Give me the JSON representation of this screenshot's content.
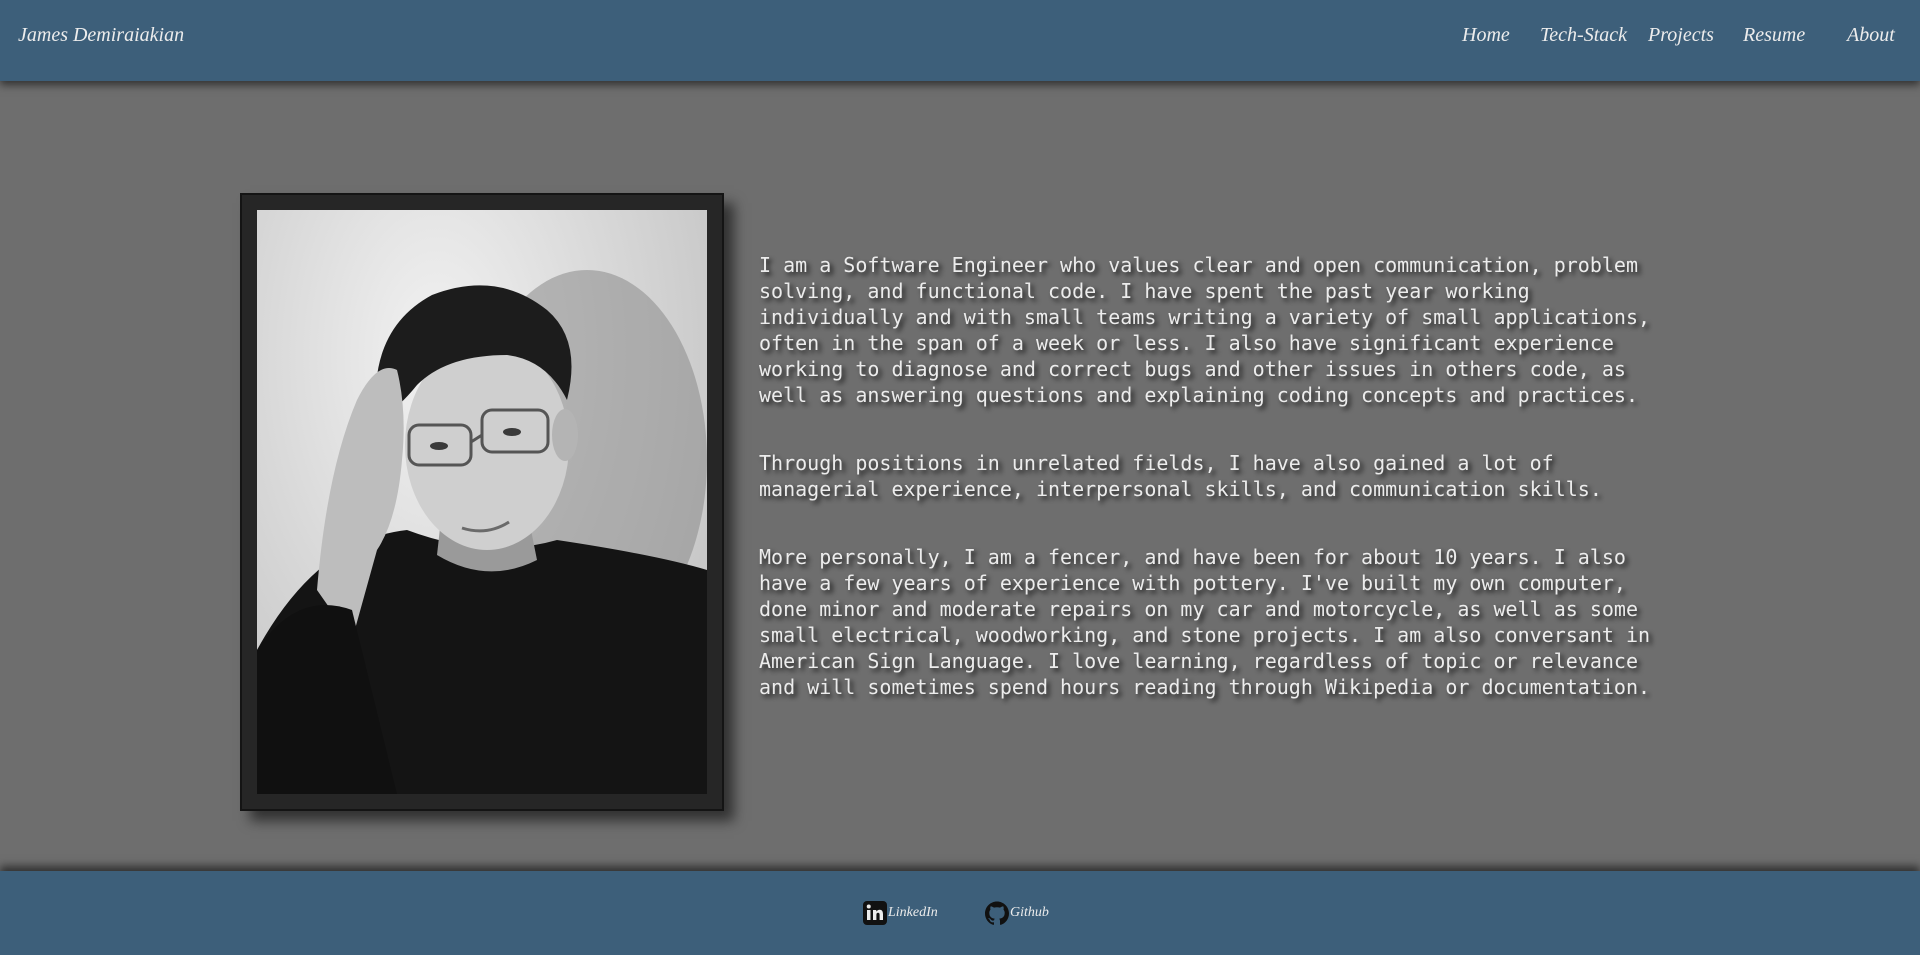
{
  "header": {
    "brand": "James Demiraiakian",
    "nav": [
      {
        "label": "Home"
      },
      {
        "label": "Tech-Stack"
      },
      {
        "label": "Projects"
      },
      {
        "label": "Resume"
      },
      {
        "label": "About"
      }
    ]
  },
  "about": {
    "paragraphs": [
      "I am a Software Engineer who values clear and open communication, problem solving, and functional code. I have spent the past year working individually and with small teams writing a variety of small applications, often in the span of a week or less. I also have significant experience working to diagnose and correct bugs and other issues in others code, as well as answering questions and explaining coding concepts and practices.",
      "Through positions in unrelated fields, I have also gained a lot of managerial experience, interpersonal skills, and communication skills.",
      "More personally, I am a fencer, and have been for about 10 years. I also have a few years of experience with pottery. I've built my own computer, done minor and moderate repairs on my car and motorcycle, as well as some small electrical, woodworking, and stone projects. I am also conversant in American Sign Language. I love learning, regardless of topic or relevance and will sometimes spend hours reading through Wikipedia or documentation."
    ]
  },
  "footer": {
    "links": [
      {
        "label": "LinkedIn",
        "icon": "linkedin-icon"
      },
      {
        "label": "Github",
        "icon": "github-icon"
      }
    ]
  },
  "colors": {
    "bar": "#3d5f7a",
    "background": "#6e6e6e",
    "text": "#ececec"
  }
}
